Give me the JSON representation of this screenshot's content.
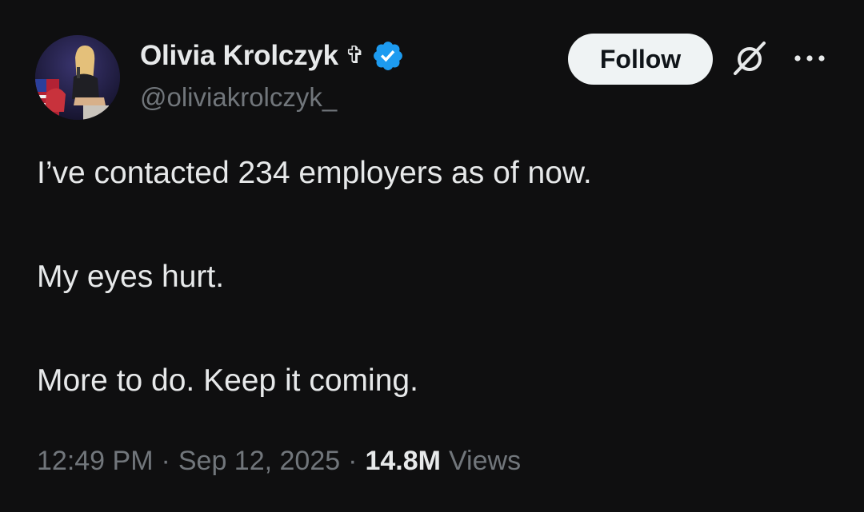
{
  "author": {
    "display_name": "Olivia Krolczyk",
    "name_emoji": "✞",
    "handle": "@oliviakrolczyk_",
    "verified": true,
    "verified_color": "#1d9bf0"
  },
  "actions": {
    "follow_label": "Follow",
    "icons": [
      "grok-icon",
      "more-icon"
    ]
  },
  "tweet": {
    "lines": [
      "I’ve contacted 234 employers as of now.",
      "My eyes hurt.",
      "More to do. Keep it coming."
    ]
  },
  "meta": {
    "time": "12:49 PM",
    "separator": "·",
    "date": "Sep 12, 2025",
    "views_count": "14.8M",
    "views_label": "Views"
  },
  "colors": {
    "background": "#0f0f10",
    "text_primary": "#e7e9ea",
    "text_secondary": "#71767b",
    "follow_bg": "#eff3f4"
  }
}
